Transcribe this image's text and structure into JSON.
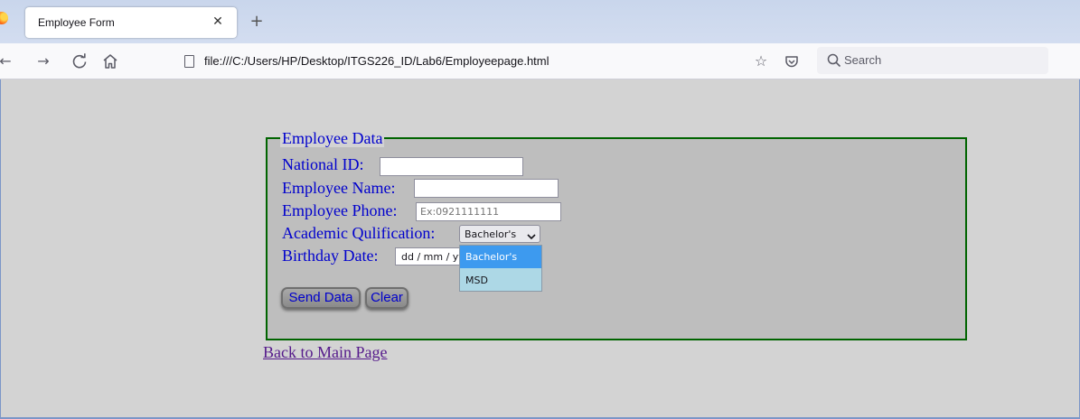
{
  "browser": {
    "tab_title": "Employee Form",
    "url": "file:///C:/Users/HP/Desktop/ITGS226_ID/Lab6/Employeepage.html",
    "search_placeholder": "Search"
  },
  "form": {
    "legend": "Employee Data",
    "national_id_label": "National ID:",
    "national_id_value": "",
    "employee_name_label": "Employee Name:",
    "employee_name_value": "",
    "employee_phone_label": "Employee Phone:",
    "employee_phone_placeholder": "Ex:0921111111",
    "qualification_label": "Academic Qulification:",
    "qualification_selected": "Bachelor's",
    "qualification_options": [
      "Bachelor's",
      "MSD"
    ],
    "birthday_label": "Birthday Date:",
    "birthday_placeholder": "dd / mm / yyyy",
    "send_button": "Send Data",
    "clear_button": "Clear"
  },
  "back_link": "Back to Main Page",
  "colors": {
    "label_text": "#0000cd",
    "fieldset_border": "#006400",
    "fieldset_bg": "#bebebe",
    "page_bg": "#d3d3d3",
    "dropdown_bg": "#add8e6",
    "dropdown_selected": "#3d9aef",
    "link_visited": "#551a8b"
  }
}
